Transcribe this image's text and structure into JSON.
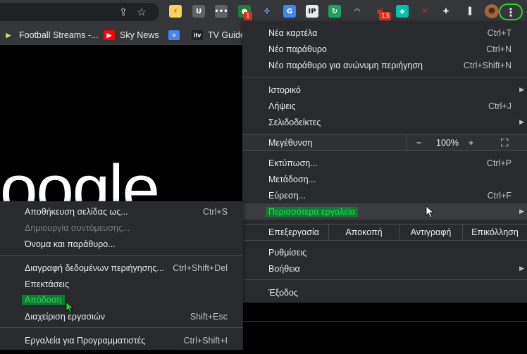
{
  "toolbar": {
    "extensions": [
      {
        "name": "lightning-extension-icon",
        "glyph": "⚡",
        "bg": "#f6d35b",
        "fg": "#c0392b"
      },
      {
        "name": "ublock-extension-icon",
        "glyph": "U",
        "bg": "#5f6368",
        "fg": "#ffffff"
      },
      {
        "name": "dots-extension-icon",
        "glyph": "•••",
        "bg": "#5f6368",
        "fg": "#ffffff"
      },
      {
        "name": "green-extension-icon",
        "glyph": "●",
        "bg": "#188038",
        "fg": "#ffffff",
        "badge": "1"
      },
      {
        "name": "network-extension-icon",
        "glyph": "✣",
        "bg": "#35363a",
        "fg": "#8ab4f8"
      },
      {
        "name": "translate-extension-icon",
        "glyph": "G",
        "bg": "#4285f4",
        "fg": "#ffffff"
      },
      {
        "name": "ip-extension-icon",
        "glyph": "IP",
        "bg": "#e8eaed",
        "fg": "#202124"
      },
      {
        "name": "refresh-extension-icon",
        "glyph": "↻",
        "bg": "#1aa260",
        "fg": "#ffffff"
      },
      {
        "name": "arch-extension-icon",
        "glyph": "◠",
        "bg": "#35363a",
        "fg": "#e8eaed"
      },
      {
        "name": "red-extension-icon",
        "glyph": "▣",
        "bg": "#35363a",
        "fg": "#d93025",
        "badge": "13"
      },
      {
        "name": "teal-extension-icon",
        "glyph": "◈",
        "bg": "#00c2a8",
        "fg": "#ffffff"
      },
      {
        "name": "slash-extension-icon",
        "glyph": "✕",
        "bg": "#35363a",
        "fg": "#d93025"
      },
      {
        "name": "puzzle-icon",
        "glyph": "✚",
        "bg": "#35363a",
        "fg": "#e8eaed"
      },
      {
        "name": "side-panel-icon",
        "glyph": "▐",
        "bg": "#35363a",
        "fg": "#e8eaed"
      },
      {
        "name": "profile-avatar",
        "glyph": "☻",
        "bg": "#a0663d",
        "fg": "#3a2414"
      }
    ],
    "menu_glyph": "⋮"
  },
  "bookmarks": [
    {
      "name": "bookmark-football-streams",
      "label": "Football Streams -...",
      "icon": "▶",
      "icon_bg": "#35363a",
      "icon_fg": "#d4e157"
    },
    {
      "name": "bookmark-sky-news",
      "label": "Sky News",
      "icon": "▶",
      "icon_bg": "#ff0000",
      "icon_fg": "#ffffff"
    },
    {
      "name": "bookmark-docs",
      "label": "",
      "icon": "≡",
      "icon_bg": "#4285f4",
      "icon_fg": "#ffffff"
    },
    {
      "name": "bookmark-tv-guide",
      "label": "TV Guide",
      "icon": "itv",
      "icon_bg": "#202124",
      "icon_fg": "#ffffff"
    }
  ],
  "page": {
    "logo_text": "oogle"
  },
  "main_menu": {
    "new_tab": {
      "label": "Νέα καρτέλα",
      "shortcut": "Ctrl+T"
    },
    "new_window": {
      "label": "Νέο παράθυρο",
      "shortcut": "Ctrl+N"
    },
    "new_incognito": {
      "label": "Νέο παράθυρο για ανώνυμη περιήγηση",
      "shortcut": "Ctrl+Shift+N"
    },
    "history": {
      "label": "Ιστορικό"
    },
    "downloads": {
      "label": "Λήψεις",
      "shortcut": "Ctrl+J"
    },
    "bookmarks": {
      "label": "Σελιδοδείκτες"
    },
    "zoom": {
      "label": "Μεγέθυνση",
      "minus": "−",
      "value": "100%",
      "plus": "+",
      "fullscreen": "⛶"
    },
    "print": {
      "label": "Εκτύπωση...",
      "shortcut": "Ctrl+P"
    },
    "cast": {
      "label": "Μετάδοση..."
    },
    "find": {
      "label": "Εύρεση...",
      "shortcut": "Ctrl+F"
    },
    "more_tools": {
      "label": "Περισσότερα εργαλεία"
    },
    "edit": {
      "label": "Επεξεργασία",
      "cut": "Αποκοπή",
      "copy": "Αντιγραφή",
      "paste": "Επικόλληση"
    },
    "settings": {
      "label": "Ρυθμίσεις"
    },
    "help": {
      "label": "Βοήθεια"
    },
    "exit": {
      "label": "Έξοδος"
    }
  },
  "sub_menu": {
    "save_page": {
      "label": "Αποθήκευση σελίδας ως...",
      "shortcut": "Ctrl+S"
    },
    "create_shortcut": {
      "label": "Δημιουργία συντόμευσης..."
    },
    "name_window": {
      "label": "Όνομα και παράθυρο..."
    },
    "clear_data": {
      "label": "Διαγραφή δεδομένων περιήγησης...",
      "shortcut": "Ctrl+Shift+Del"
    },
    "extensions": {
      "label": "Επεκτάσεις"
    },
    "performance": {
      "label": "Απόδοση"
    },
    "task_manager": {
      "label": "Διαχείριση εργασιών",
      "shortcut": "Shift+Esc"
    },
    "dev_tools": {
      "label": "Εργαλεία για Προγραμματιστές",
      "shortcut": "Ctrl+Shift+I"
    }
  },
  "colors": {
    "highlight_bg": "#0e7a33",
    "highlight_fg": "#1fe04e",
    "ring": "#2bd62b"
  }
}
